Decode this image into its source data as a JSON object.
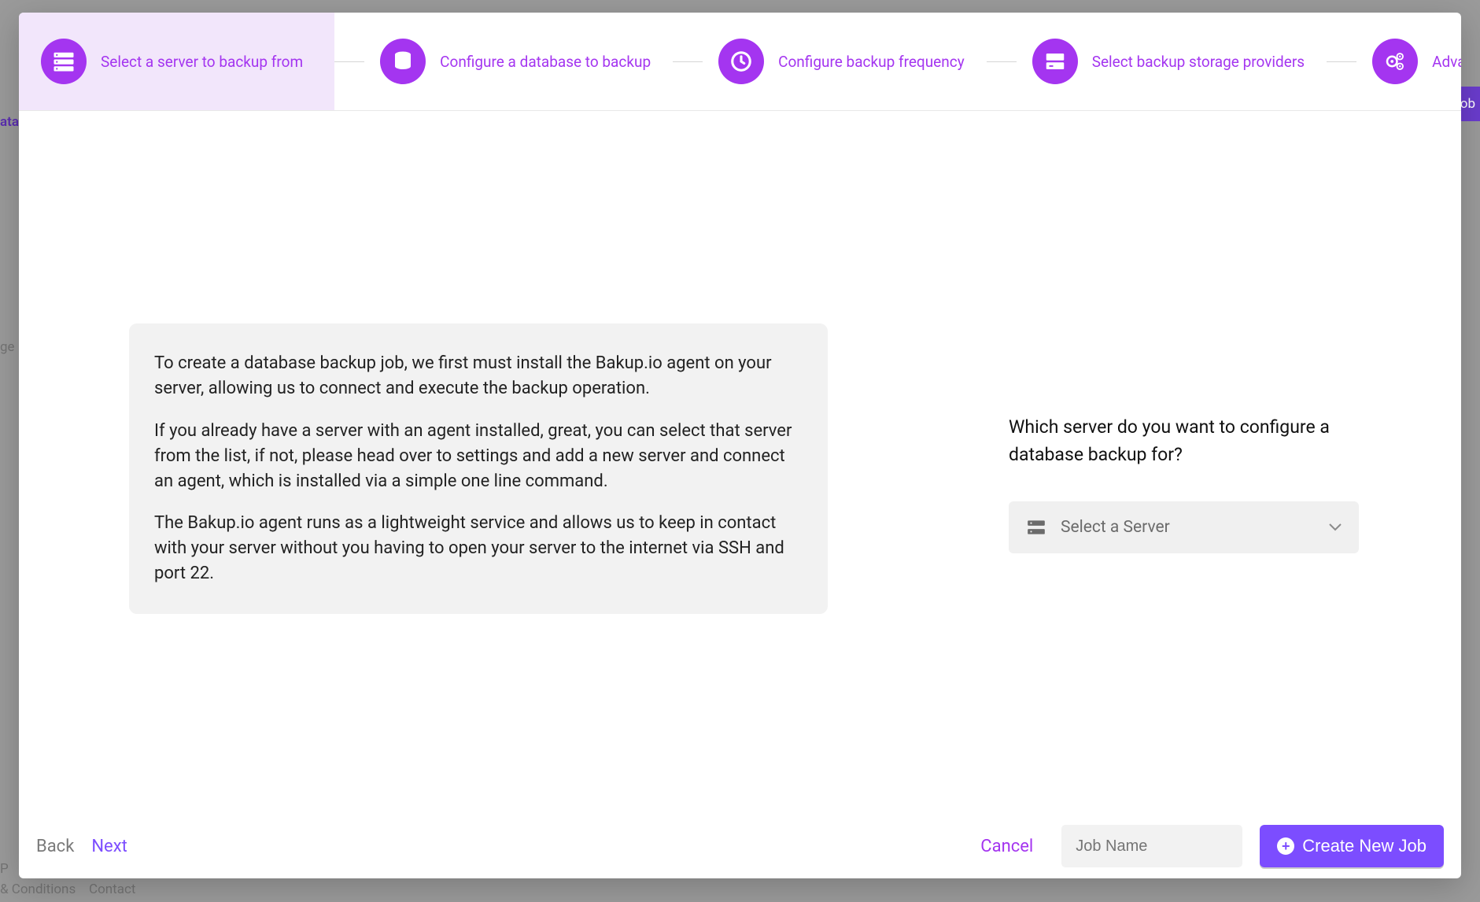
{
  "stepper": {
    "steps": [
      {
        "label": "Select a server to backup from"
      },
      {
        "label": "Configure a database to backup"
      },
      {
        "label": "Configure backup frequency"
      },
      {
        "label": "Select backup storage providers"
      },
      {
        "label": "Advanced Configuration"
      }
    ]
  },
  "info": {
    "p1": "To create a database backup job, we first must install the Bakup.io agent on your server, allowing us to connect and execute the backup operation.",
    "p2": "If you already have a server with an agent installed, great, you can select that server from the list, if not, please head over to settings and add a new server and connect an agent, which is installed via a simple one line command.",
    "p3": "The Bakup.io agent runs as a lightweight service and allows us to keep in contact with your server without you having to open your server to the internet via SSH and port 22."
  },
  "right": {
    "prompt": "Which server do you want to configure a database backup for?",
    "select_placeholder": "Select a Server"
  },
  "footer": {
    "back": "Back",
    "next": "Next",
    "cancel": "Cancel",
    "job_name_placeholder": "Job Name",
    "create_btn": "Create New Job"
  },
  "background": {
    "ata": "ata",
    "ge": "ge",
    "p": "P",
    "terms": "& Conditions",
    "contact": "Contact",
    "ob": "ob"
  }
}
